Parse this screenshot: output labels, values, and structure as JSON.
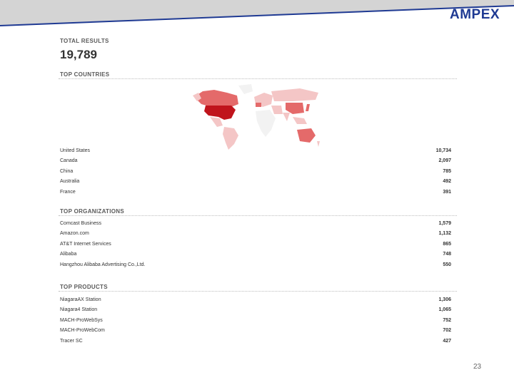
{
  "brand": {
    "name": "AMPEX"
  },
  "summary": {
    "total_label": "TOTAL RESULTS",
    "total_value": "19,789"
  },
  "top_countries": {
    "title": "TOP COUNTRIES",
    "rows": [
      {
        "name": "United States",
        "value": "10,734"
      },
      {
        "name": "Canada",
        "value": "2,097"
      },
      {
        "name": "China",
        "value": "785"
      },
      {
        "name": "Australia",
        "value": "492"
      },
      {
        "name": "France",
        "value": "391"
      }
    ]
  },
  "top_organizations": {
    "title": "TOP ORGANIZATIONS",
    "rows": [
      {
        "name": "Comcast Business",
        "value": "1,579"
      },
      {
        "name": "Amazon.com",
        "value": "1,132"
      },
      {
        "name": "AT&T Internet Services",
        "value": "865"
      },
      {
        "name": "Alibaba",
        "value": "748"
      },
      {
        "name": "Hangzhou Alibaba Advertising Co.,Ltd.",
        "value": "550"
      }
    ]
  },
  "top_products": {
    "title": "TOP PRODUCTS",
    "rows": [
      {
        "name": "NiagaraAX Station",
        "value": "1,306"
      },
      {
        "name": "Niagara4 Station",
        "value": "1,065"
      },
      {
        "name": "MACH-ProWebSys",
        "value": "752"
      },
      {
        "name": "MACH-ProWebCom",
        "value": "702"
      },
      {
        "name": "Tracer SC",
        "value": "427"
      }
    ]
  },
  "page": {
    "number": "23"
  },
  "colors": {
    "brand": "#1f3a93",
    "map_dark": "#c0141c",
    "map_mid": "#e46a6a",
    "map_light": "#f4c6c6",
    "map_none": "#f2f2f2"
  }
}
